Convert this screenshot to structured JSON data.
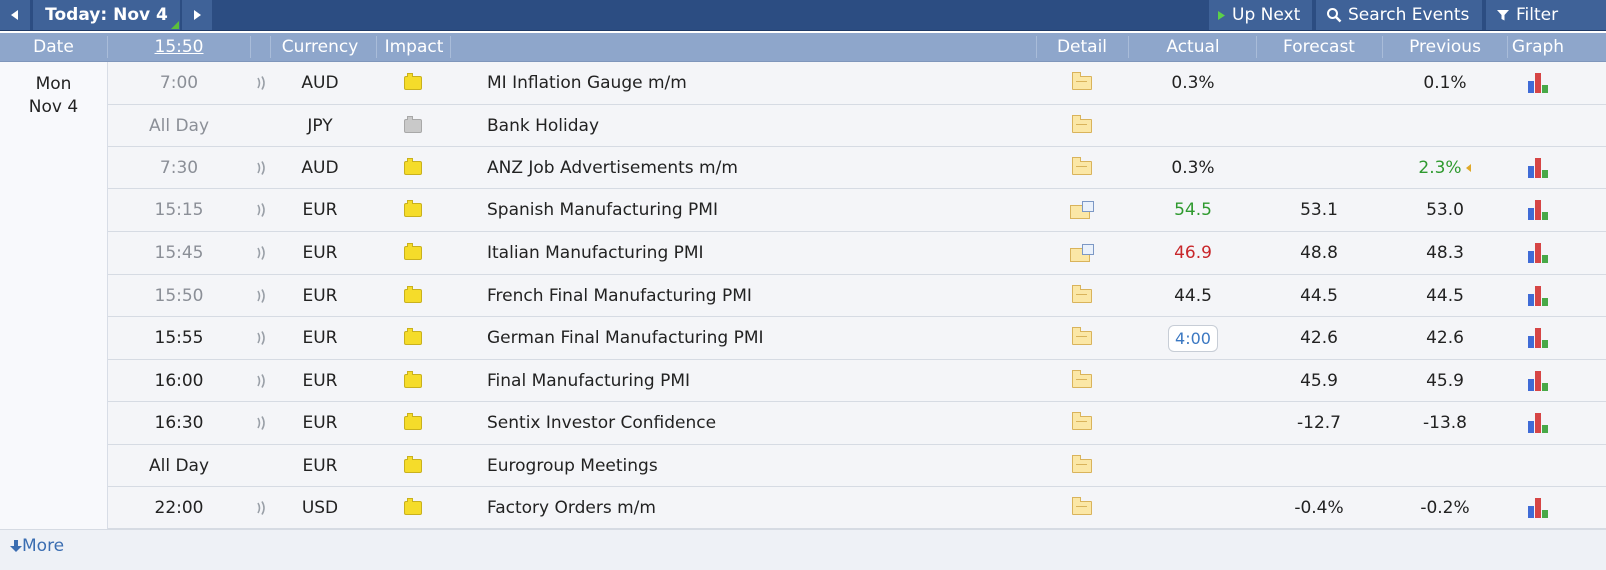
{
  "toolbar": {
    "today_label": "Today: Nov 4",
    "up_next_label": "Up Next",
    "search_label": "Search Events",
    "filter_label": "Filter"
  },
  "header": {
    "date": "Date",
    "time": "15:50",
    "currency": "Currency",
    "impact": "Impact",
    "detail": "Detail",
    "actual": "Actual",
    "forecast": "Forecast",
    "previous": "Previous",
    "graph": "Graph"
  },
  "date_group": {
    "day": "Mon",
    "date": "Nov 4"
  },
  "rows": [
    {
      "time": "7:00",
      "past": true,
      "sound": true,
      "currency": "AUD",
      "impact": "yellow",
      "event": "MI Inflation Gauge m/m",
      "detail": "folder",
      "actual": "0.3%",
      "actual_color": "",
      "forecast": "",
      "previous": "0.1%",
      "previous_color": "",
      "graph": true
    },
    {
      "time": "All Day",
      "past": true,
      "sound": false,
      "currency": "JPY",
      "impact": "gray",
      "event": "Bank Holiday",
      "detail": "folder",
      "actual": "",
      "actual_color": "",
      "forecast": "",
      "previous": "",
      "previous_color": "",
      "graph": false
    },
    {
      "time": "7:30",
      "past": true,
      "sound": true,
      "currency": "AUD",
      "impact": "yellow",
      "event": "ANZ Job Advertisements m/m",
      "detail": "folder",
      "actual": "0.3%",
      "actual_color": "",
      "forecast": "",
      "previous": "2.3%",
      "previous_color": "green",
      "revised": true,
      "graph": true
    },
    {
      "time": "15:15",
      "past": true,
      "sound": true,
      "currency": "EUR",
      "impact": "yellow",
      "event": "Spanish Manufacturing PMI",
      "detail": "news",
      "actual": "54.5",
      "actual_color": "green",
      "forecast": "53.1",
      "previous": "53.0",
      "previous_color": "",
      "graph": true
    },
    {
      "time": "15:45",
      "past": true,
      "sound": true,
      "currency": "EUR",
      "impact": "yellow",
      "event": "Italian Manufacturing PMI",
      "detail": "news",
      "actual": "46.9",
      "actual_color": "red",
      "forecast": "48.8",
      "previous": "48.3",
      "previous_color": "",
      "graph": true
    },
    {
      "time": "15:50",
      "past": true,
      "sound": true,
      "currency": "EUR",
      "impact": "yellow",
      "event": "French Final Manufacturing PMI",
      "detail": "folder",
      "actual": "44.5",
      "actual_color": "",
      "forecast": "44.5",
      "previous": "44.5",
      "previous_color": "",
      "graph": true
    },
    {
      "time": "15:55",
      "past": false,
      "sound": true,
      "currency": "EUR",
      "impact": "yellow",
      "event": "German Final Manufacturing PMI",
      "detail": "folder",
      "actual": "4:00",
      "actual_color": "countdown",
      "forecast": "42.6",
      "previous": "42.6",
      "previous_color": "",
      "graph": true
    },
    {
      "time": "16:00",
      "past": false,
      "sound": true,
      "currency": "EUR",
      "impact": "yellow",
      "event": "Final Manufacturing PMI",
      "detail": "folder",
      "actual": "",
      "actual_color": "",
      "forecast": "45.9",
      "previous": "45.9",
      "previous_color": "",
      "graph": true
    },
    {
      "time": "16:30",
      "past": false,
      "sound": true,
      "currency": "EUR",
      "impact": "yellow",
      "event": "Sentix Investor Confidence",
      "detail": "folder",
      "actual": "",
      "actual_color": "",
      "forecast": "-12.7",
      "previous": "-13.8",
      "previous_color": "",
      "graph": true
    },
    {
      "time": "All Day",
      "past": false,
      "sound": false,
      "currency": "EUR",
      "impact": "yellow",
      "event": "Eurogroup Meetings",
      "detail": "folder",
      "actual": "",
      "actual_color": "",
      "forecast": "",
      "previous": "",
      "previous_color": "",
      "graph": false
    },
    {
      "time": "22:00",
      "past": false,
      "sound": true,
      "currency": "USD",
      "impact": "yellow",
      "event": "Factory Orders m/m",
      "detail": "folder",
      "actual": "",
      "actual_color": "",
      "forecast": "-0.4%",
      "previous": "-0.2%",
      "previous_color": "",
      "graph": true
    }
  ],
  "more_label": "More",
  "colors": {
    "toolbar_bg": "#2c4d82",
    "header_bg": "#8ea6cb",
    "better": "#2f9a2f",
    "worse": "#c8262a",
    "impact_yellow": "#f5dc2a",
    "impact_gray": "#c9c9c9"
  },
  "icons": {
    "prev": "triangle-left-icon",
    "next": "triangle-right-icon",
    "up_next": "play-icon",
    "search": "magnifier-icon",
    "filter": "funnel-icon",
    "sound": "sound-wave-icon",
    "impact": "impact-folder-icon",
    "detail": "folder-icon",
    "graph": "bar-chart-icon",
    "more": "down-arrow-icon"
  }
}
